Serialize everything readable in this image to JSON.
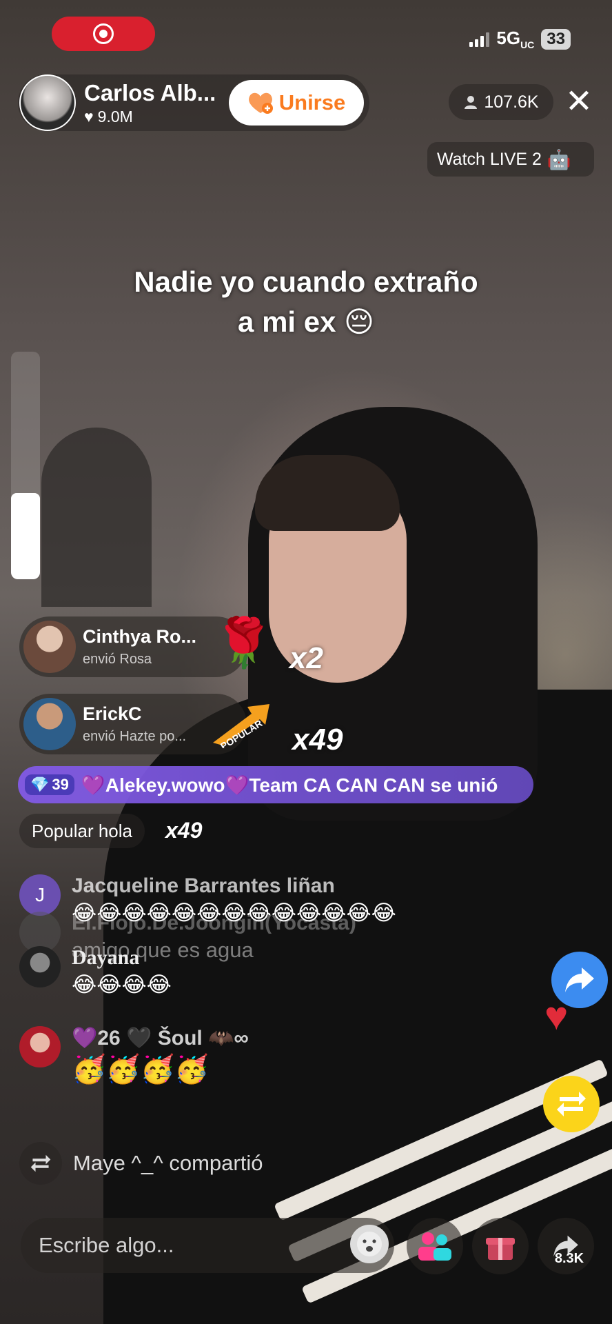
{
  "status_bar": {
    "network": "5G",
    "network_sub": "UC",
    "battery": "33"
  },
  "header": {
    "host_name": "Carlos Alb...",
    "host_likes": "9.0M",
    "join_label": "Unirse",
    "viewer_count": "107.6K",
    "watch_live_label": "Watch LIVE 2"
  },
  "caption": {
    "line1": "Nadie yo cuando extraño",
    "line2": "a mi ex 😔"
  },
  "zoom_level": 0.38,
  "gifts": [
    {
      "name": "Cinthya Ro...",
      "subtitle": "envió Rosa",
      "count": "x2"
    },
    {
      "name": "ErickC",
      "subtitle": "envió Hazte po...",
      "count": "x49",
      "badge": "POPULAR"
    }
  ],
  "join_banner": {
    "level": "39",
    "text": "💜Alekey.wowo💜Team CA CAN CAN se unió"
  },
  "popular_row": {
    "text": "Popular hola",
    "count": "x49"
  },
  "chat": [
    {
      "name": "Jacqueline Barrantes liñan",
      "text": "😂😂😂😂😂😂😂😂😂😂😂😂😂",
      "avatar_letter": "J"
    },
    {
      "name": "El.Flojo.De.Joongin(Yocasta)",
      "text": "amigo que es agua"
    },
    {
      "name": "Dayana",
      "text": "😂😂😂😂"
    },
    {
      "name": "💜26 🖤 Šoul 🦇∞",
      "level": "26",
      "text": "🥳🥳🥳🥳"
    }
  ],
  "shared": {
    "text": "Maye ^_^ compartió"
  },
  "bottom_bar": {
    "comment_placeholder": "Escribe algo...",
    "share_count": "8.3K"
  },
  "colors": {
    "record": "#d9202e",
    "join_text": "#fa7b1f",
    "banner": "#7e5ae6",
    "share": "#3c8cf0",
    "repost": "#fbd41a"
  }
}
